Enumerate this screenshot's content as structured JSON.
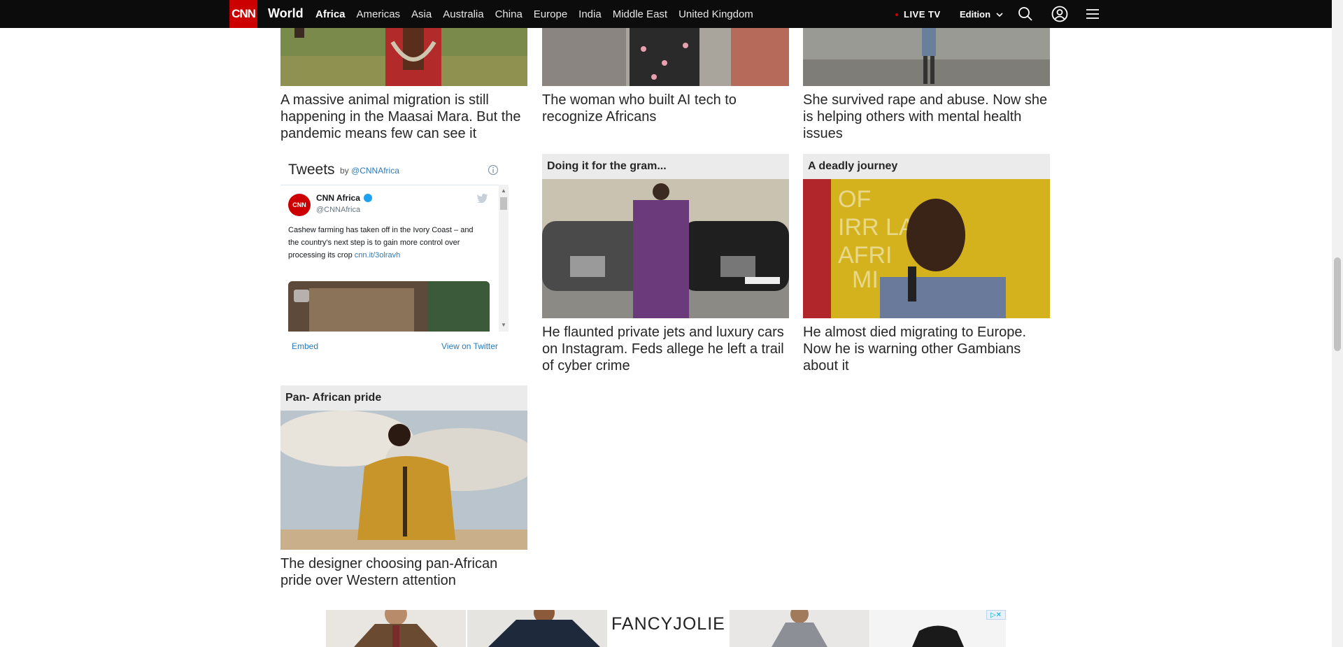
{
  "nav": {
    "logo": "CNN",
    "section": "World",
    "links": [
      "Africa",
      "Americas",
      "Asia",
      "Australia",
      "China",
      "Europe",
      "India",
      "Middle East",
      "United Kingdom"
    ],
    "active_link": "Africa",
    "live_tv": "LIVE TV",
    "edition": "Edition",
    "icons": [
      "search-icon",
      "account-icon",
      "menu-icon"
    ]
  },
  "top_cards": [
    {
      "headline": "A massive animal migration is still happening in the Maasai Mara. But the pandemic means few can see it"
    },
    {
      "headline": "The woman who built AI tech to recognize Africans"
    },
    {
      "headline": "She survived rape and abuse. Now she is helping others with mental health issues"
    }
  ],
  "tweets": {
    "title": "Tweets",
    "by_prefix": "by",
    "by_handle": "@CNNAfrica",
    "author_name": "CNN Africa",
    "author_handle": "@CNNAfrica",
    "text": "Cashew farming has taken off in the Ivory Coast – and the country's next step is to gain more control over processing its crop",
    "link": "cnn.it/3olravh",
    "embed": "Embed",
    "view_on_twitter": "View on Twitter"
  },
  "mid_cards": [
    {
      "banner": "Doing it for the gram...",
      "headline": "He flaunted private jets and luxury cars on Instagram. Feds allege he left a trail of cyber crime"
    },
    {
      "banner": "A deadly journey",
      "headline": "He almost died migrating to Europe. Now he is warning other Gambians about it"
    }
  ],
  "bottom_card": {
    "banner": "Pan- African pride",
    "headline": "The designer choosing pan-African pride over Western attention"
  },
  "ad": {
    "brand": "FANCYJOLIE",
    "choice": "▷✕"
  },
  "colors": {
    "nav_bg": "#0c0c0c",
    "cnn_red": "#cc0000",
    "banner_bg": "#ebebeb",
    "twitter_link": "#2b7bb9"
  }
}
